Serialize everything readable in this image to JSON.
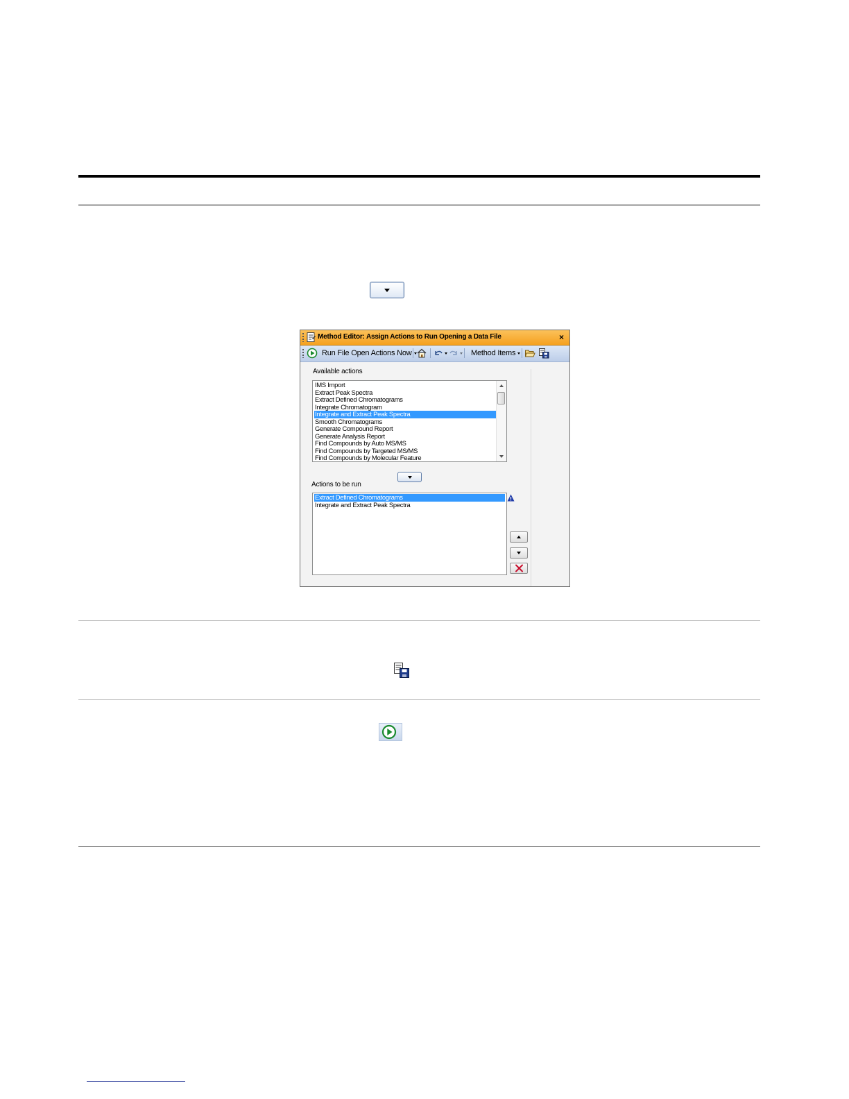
{
  "window": {
    "title": "Method Editor: Assign Actions to Run Opening a Data File",
    "close_label": "×"
  },
  "toolbar": {
    "run_label": "Run File Open Actions Now",
    "method_items_label": "Method Items"
  },
  "available": {
    "label": "Available actions",
    "items": [
      "IMS Import",
      "Extract Peak Spectra",
      "Extract Defined Chromatograms",
      "Integrate Chromatogram",
      "Integrate and Extract Peak Spectra",
      "Smooth Chromatograms",
      "Generate Compound Report",
      "Generate Analysis Report",
      "Find Compounds by Auto MS/MS",
      "Find Compounds by Targeted MS/MS",
      "Find Compounds by Molecular Feature"
    ],
    "selected_index": 4
  },
  "to_run": {
    "label": "Actions to be run",
    "items": [
      "Extract Defined Chromatograms",
      "Integrate and Extract Peak Spectra"
    ],
    "selected_index": 0
  },
  "icons": {
    "page_dropdown": "dropdown-arrow-icon",
    "page_save": "save-method-icon",
    "page_run": "run-play-icon",
    "title": "document-icon",
    "toolbar": [
      "run-play-icon",
      "home-icon",
      "undo-icon",
      "redo-icon",
      "open-folder-icon",
      "save-method-icon"
    ],
    "warning": "warning-icon",
    "move_down": "arrow-down-icon",
    "move_item_up": "arrow-up-icon",
    "move_item_down": "arrow-down-icon",
    "remove": "delete-x-icon"
  },
  "colors": {
    "title_bar": "#f5a11f",
    "toolbar": "#c9d7ec",
    "selection": "#3399ff",
    "run_icon": "#1a8a2e",
    "warning": "#1e3aa8",
    "remove": "#c8102e"
  }
}
